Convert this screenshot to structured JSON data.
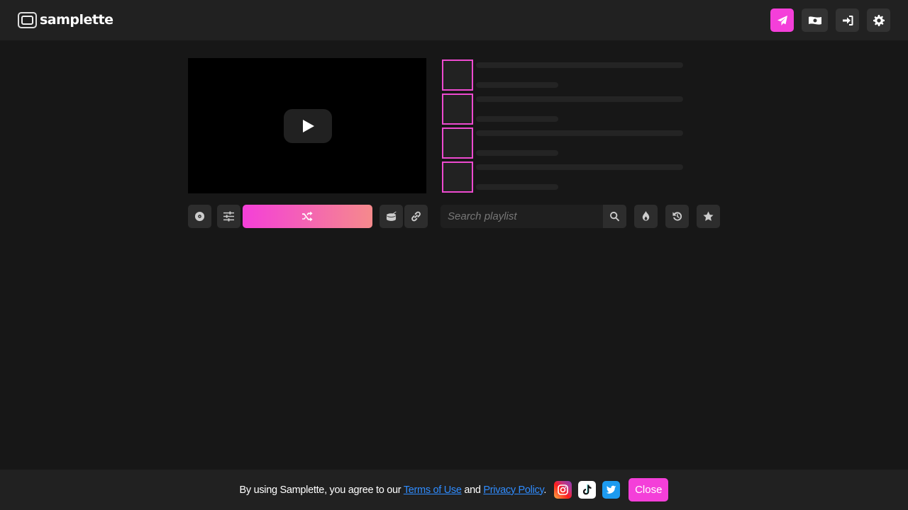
{
  "header": {
    "logo_text": "samplette",
    "actions": [
      {
        "name": "submit",
        "icon": "paper-plane-icon",
        "color": "#f43fd9"
      },
      {
        "name": "donate",
        "icon": "money-bill-icon"
      },
      {
        "name": "login",
        "icon": "sign-in-icon"
      },
      {
        "name": "settings",
        "icon": "gear-icon"
      }
    ]
  },
  "player": {
    "play_icon": "play-icon"
  },
  "playlist": {
    "items": [
      {
        "state": "loading"
      },
      {
        "state": "loading"
      },
      {
        "state": "loading"
      },
      {
        "state": "loading"
      }
    ]
  },
  "controls": {
    "left": [
      {
        "name": "vinyl",
        "icon": "record-icon"
      },
      {
        "name": "filters",
        "icon": "sliders-icon"
      },
      {
        "name": "shuffle",
        "icon": "shuffle-icon"
      },
      {
        "name": "drum",
        "icon": "drum-icon"
      },
      {
        "name": "link",
        "icon": "link-icon"
      }
    ],
    "search": {
      "placeholder": "Search playlist",
      "value": ""
    },
    "right": [
      {
        "name": "trending",
        "icon": "fire-icon"
      },
      {
        "name": "history",
        "icon": "history-icon"
      },
      {
        "name": "favorites",
        "icon": "star-icon"
      }
    ]
  },
  "cookie_banner": {
    "text_before": "By using Samplette, you agree to our ",
    "terms_link": "Terms of Use",
    "text_and": " and ",
    "privacy_link": "Privacy Policy",
    "text_after": ".",
    "socials": [
      "instagram",
      "tiktok",
      "twitter"
    ],
    "close_label": "Close"
  },
  "colors": {
    "accent": "#f43fd9",
    "accent_end": "#f58a8c",
    "link": "#2f8cff",
    "background": "#171717",
    "bar": "#212121"
  }
}
